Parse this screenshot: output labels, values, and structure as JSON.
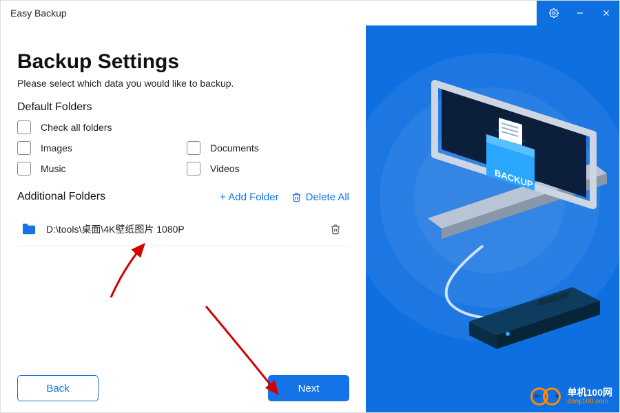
{
  "app": {
    "title": "Easy Backup"
  },
  "page": {
    "heading": "Backup Settings",
    "subtitle": "Please select which data you would like to backup."
  },
  "default_folders": {
    "section_label": "Default Folders",
    "check_all_label": "Check all folders",
    "items": [
      {
        "label": "Images",
        "checked": false
      },
      {
        "label": "Documents",
        "checked": false
      },
      {
        "label": "Music",
        "checked": false
      },
      {
        "label": "Videos",
        "checked": false
      }
    ]
  },
  "additional_folders": {
    "section_label": "Additional Folders",
    "add_label": "+ Add Folder",
    "delete_all_label": "Delete All",
    "items": [
      {
        "path": "D:\\tools\\桌面\\4K壁纸图片 1080P"
      }
    ]
  },
  "footer": {
    "back_label": "Back",
    "next_label": "Next"
  },
  "illustration": {
    "badge_text": "BACKUP"
  },
  "watermark": {
    "line1": "单机100网",
    "line2": "danji100.com"
  },
  "colors": {
    "accent": "#1473e6",
    "panel": "#0e6fe1",
    "brand_orange": "#ff8a00"
  }
}
